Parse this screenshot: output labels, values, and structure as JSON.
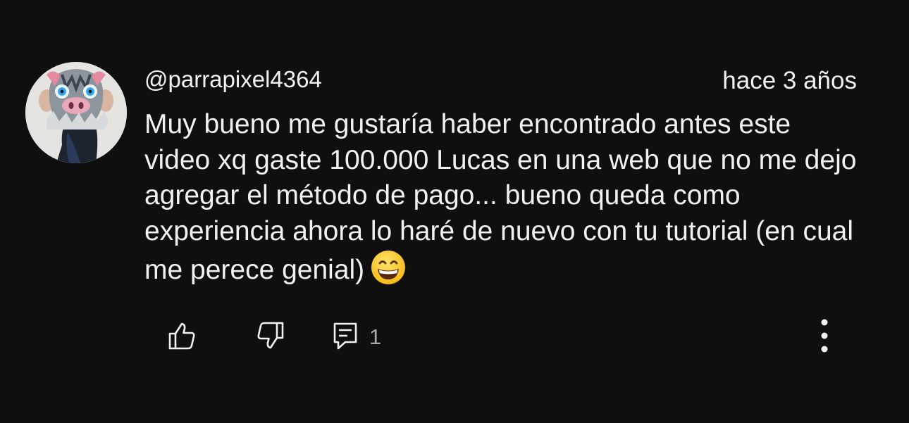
{
  "comment": {
    "author": "@parrapixel4364",
    "timestamp": "hace 3 años",
    "text": "Muy bueno me gustaría haber encontrado antes este video xq gaste 100.000 Lucas en una web que no me dejo agregar el método de pago... bueno queda como experiencia ahora lo haré de nuevo con tu tutorial (en cual me perece genial)",
    "emoji": "grinning-face-with-smiling-eyes",
    "avatar": "mask-avatar"
  },
  "actions": {
    "like_icon": "thumb-up-icon",
    "dislike_icon": "thumb-down-icon",
    "reply_icon": "reply-comment-icon",
    "reply_count": "1",
    "more_icon": "more-vertical-icon"
  },
  "colors": {
    "background": "#0f0f0f",
    "text": "#f1f1f1",
    "secondary_text": "#aaaaaa"
  }
}
